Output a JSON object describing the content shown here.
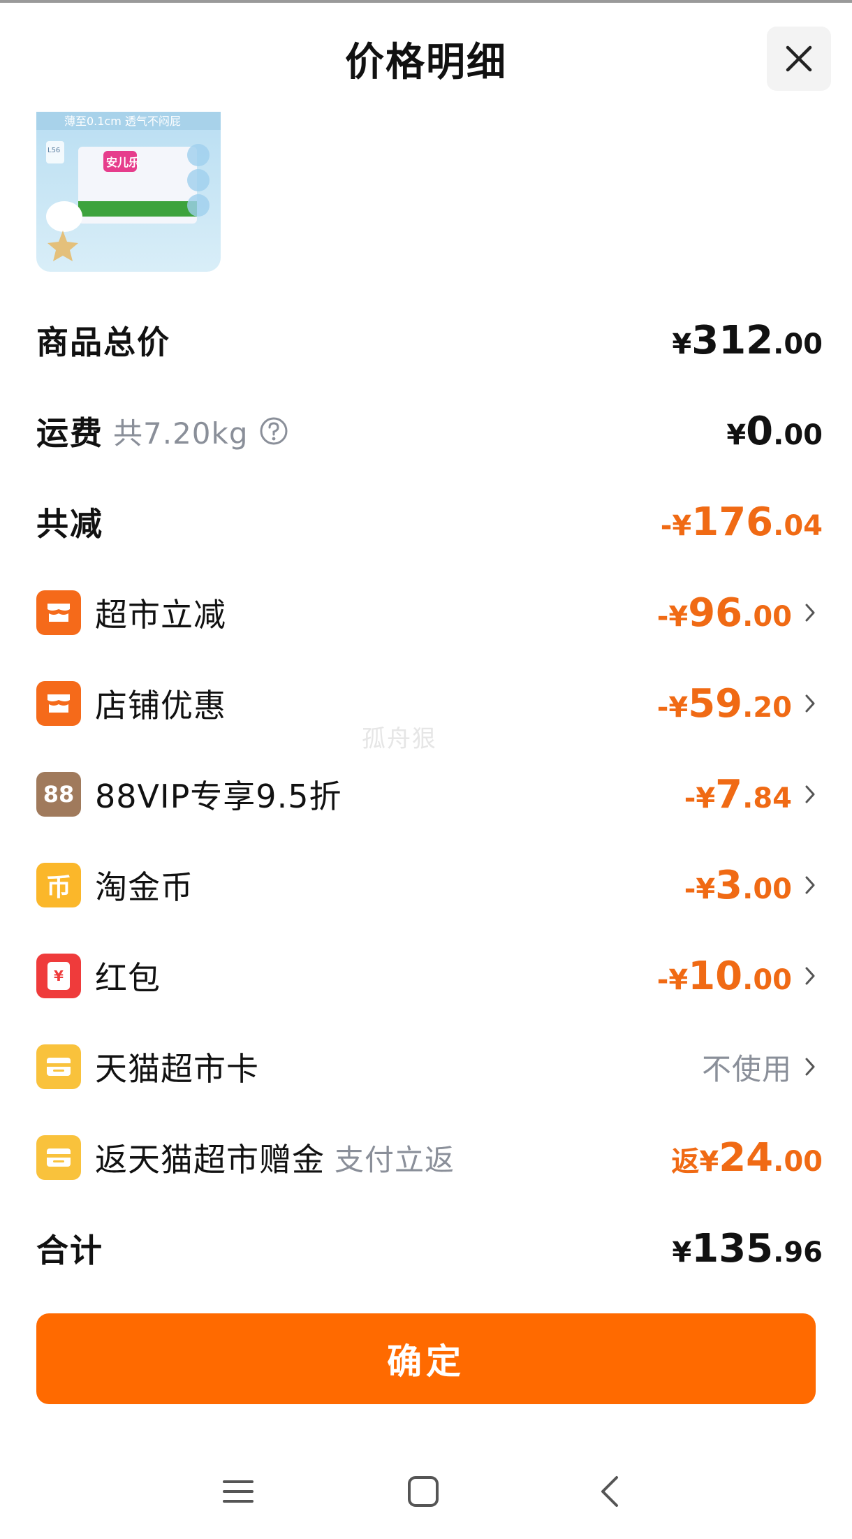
{
  "header": {
    "title": "价格明细"
  },
  "product": {
    "image_text_top": "薄至0.1cm 透气不闷屁",
    "image_text_size": "L56",
    "image_text_brand": "安儿乐"
  },
  "rows": {
    "total": {
      "label": "商品总价",
      "currency": "¥",
      "int": "312",
      "dec": ".00"
    },
    "shipping": {
      "label": "运费",
      "sub": "共7.20kg",
      "currency": "¥",
      "int": "0",
      "dec": ".00"
    },
    "discount": {
      "label": "共减",
      "prefix": "-¥",
      "int": "176",
      "dec": ".04"
    },
    "supermarket": {
      "label": "超市立减",
      "prefix": "-¥",
      "int": "96",
      "dec": ".00"
    },
    "store": {
      "label": "店铺优惠",
      "prefix": "-¥",
      "int": "59",
      "dec": ".20"
    },
    "vip": {
      "label": "88VIP专享9.5折",
      "icon_text": "88",
      "prefix": "-¥",
      "int": "7",
      "dec": ".84"
    },
    "coins": {
      "label": "淘金币",
      "icon_text": "币",
      "prefix": "-¥",
      "int": "3",
      "dec": ".00"
    },
    "redpacket": {
      "label": "红包",
      "icon_text": "¥",
      "prefix": "-¥",
      "int": "10",
      "dec": ".00"
    },
    "card": {
      "label": "天猫超市卡",
      "value": "不使用"
    },
    "rebate": {
      "label": "返天猫超市赠金",
      "sub": "支付立返",
      "prefix": "返¥",
      "int": "24",
      "dec": ".00"
    },
    "sum": {
      "label": "合计",
      "currency": "¥",
      "int": "135",
      "dec": ".96"
    }
  },
  "watermark": "孤舟狠",
  "footer": {
    "confirm_label": "确定"
  },
  "icons": {
    "close": "close-icon",
    "info": "question-circle-icon",
    "chevron": "chevron-right-icon",
    "nav_menu": "menu-icon",
    "nav_home": "square-home-icon",
    "nav_back": "back-chevron-icon"
  },
  "colors": {
    "accent_orange": "#ff6a00",
    "amount_orange": "#f06a14",
    "icon_orange": "#f56a1a",
    "icon_bronze": "#a07a5c",
    "icon_yellow": "#fbb72a",
    "icon_red": "#ef3b3b",
    "icon_card_yellow": "#f9c23c"
  }
}
